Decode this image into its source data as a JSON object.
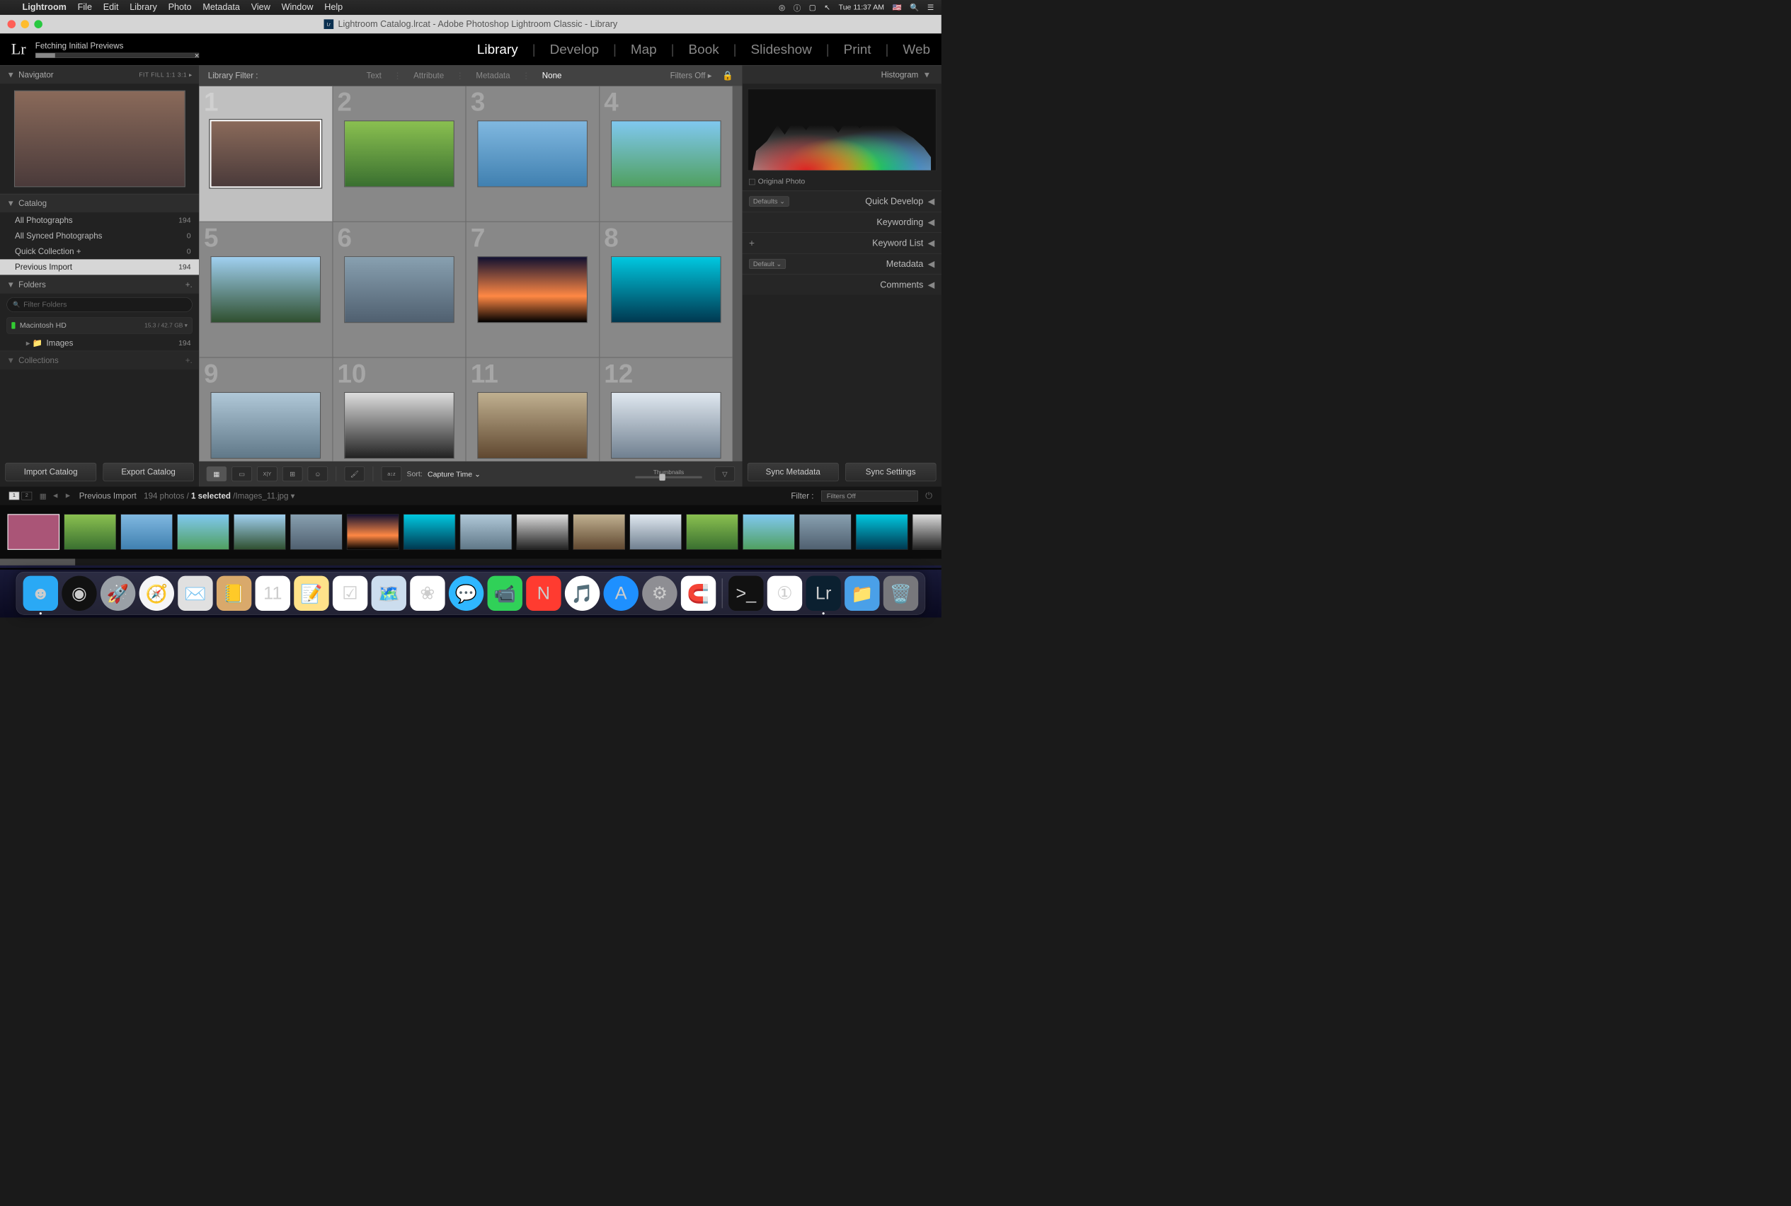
{
  "menubar": {
    "app": "Lightroom",
    "items": [
      "File",
      "Edit",
      "Library",
      "Photo",
      "Metadata",
      "View",
      "Window",
      "Help"
    ],
    "clock": "Tue 11:37 AM"
  },
  "window": {
    "title": "Lightroom Catalog.lrcat - Adobe Photoshop Lightroom Classic - Library"
  },
  "header": {
    "logo": "Lr",
    "status": "Fetching Initial Previews",
    "modules": [
      "Library",
      "Develop",
      "Map",
      "Book",
      "Slideshow",
      "Print",
      "Web"
    ],
    "active_module": "Library"
  },
  "left": {
    "navigator": {
      "title": "Navigator",
      "zoom_opts": "FIT   FILL   1:1   3:1  ▸"
    },
    "catalog": {
      "title": "Catalog",
      "items": [
        {
          "label": "All Photographs",
          "count": "194"
        },
        {
          "label": "All Synced Photographs",
          "count": "0"
        },
        {
          "label": "Quick Collection  +",
          "count": "0"
        },
        {
          "label": "Previous Import",
          "count": "194",
          "selected": true
        }
      ]
    },
    "folders": {
      "title": "Folders",
      "filter_placeholder": "Filter Folders",
      "volume": {
        "name": "Macintosh HD",
        "cap": "15.3 / 42.7 GB  ▾"
      },
      "items": [
        {
          "label": "Images",
          "count": "194"
        }
      ]
    },
    "collections": {
      "title": "Collections"
    },
    "footer": {
      "import": "Import Catalog",
      "export": "Export Catalog"
    }
  },
  "filterbar": {
    "label": "Library Filter :",
    "opts": [
      "Text",
      "Attribute",
      "Metadata",
      "None"
    ],
    "active": "None",
    "filters_off": "Filters Off  ▸"
  },
  "grid": {
    "cells": [
      1,
      2,
      3,
      4,
      5,
      6,
      7,
      8,
      9,
      10,
      11,
      12
    ],
    "selected": 1
  },
  "toolbar": {
    "sort_label": "Sort:",
    "sort_value": "Capture Time",
    "thumbnails_label": "Thumbnails"
  },
  "right": {
    "histogram_title": "Histogram",
    "original_photo": "Original Photo",
    "rows": [
      {
        "label": "Quick Develop",
        "dropdown": "Defaults"
      },
      {
        "label": "Keywording"
      },
      {
        "label": "Keyword List",
        "plus": true
      },
      {
        "label": "Metadata",
        "dropdown": "Default"
      },
      {
        "label": "Comments"
      }
    ],
    "footer": {
      "sync_meta": "Sync Metadata",
      "sync_settings": "Sync Settings"
    }
  },
  "filmstrip_meta": {
    "source": "Previous Import",
    "count": "194 photos",
    "selected": "1 selected",
    "file": "Images_11.jpg",
    "filter_label": "Filter :",
    "filter_value": "Filters Off"
  },
  "dock": {
    "icons": [
      {
        "name": "finder",
        "color": "#2aa9f5",
        "glyph": "☻",
        "round": false,
        "running": true
      },
      {
        "name": "siri",
        "color": "#111",
        "glyph": "◉",
        "round": true
      },
      {
        "name": "launchpad",
        "color": "#9aa0a6",
        "glyph": "🚀",
        "round": true
      },
      {
        "name": "safari",
        "color": "#f5f5f7",
        "glyph": "🧭",
        "round": true
      },
      {
        "name": "mail",
        "color": "#e0e0e0",
        "glyph": "✉️",
        "round": false
      },
      {
        "name": "contacts",
        "color": "#d9a96b",
        "glyph": "📒",
        "round": false
      },
      {
        "name": "calendar",
        "color": "#fff",
        "glyph": "11",
        "round": false
      },
      {
        "name": "notes",
        "color": "#ffe28a",
        "glyph": "📝",
        "round": false
      },
      {
        "name": "reminders",
        "color": "#fff",
        "glyph": "☑︎",
        "round": false
      },
      {
        "name": "maps",
        "color": "#cde",
        "glyph": "🗺️",
        "round": false
      },
      {
        "name": "photos",
        "color": "#fff",
        "glyph": "❀",
        "round": false
      },
      {
        "name": "messages",
        "color": "#2fb7ff",
        "glyph": "💬",
        "round": true
      },
      {
        "name": "facetime",
        "color": "#30d158",
        "glyph": "📹",
        "round": false
      },
      {
        "name": "news",
        "color": "#ff3b30",
        "glyph": "N",
        "round": false
      },
      {
        "name": "music",
        "color": "#fff",
        "glyph": "🎵",
        "round": true
      },
      {
        "name": "appstore",
        "color": "#1e90ff",
        "glyph": "A",
        "round": true
      },
      {
        "name": "preferences",
        "color": "#8e8e93",
        "glyph": "⚙︎",
        "round": true
      },
      {
        "name": "magnet",
        "color": "#fff",
        "glyph": "🧲",
        "round": false
      }
    ],
    "right_icons": [
      {
        "name": "terminal",
        "color": "#111",
        "glyph": ">_",
        "round": false
      },
      {
        "name": "1password",
        "color": "#fff",
        "glyph": "①",
        "round": false
      },
      {
        "name": "lightroom",
        "color": "#0b2030",
        "glyph": "Lr",
        "round": false,
        "running": true
      },
      {
        "name": "downloads",
        "color": "#4aa0e8",
        "glyph": "📁",
        "round": false
      },
      {
        "name": "trash",
        "color": "#78787c",
        "glyph": "🗑️",
        "round": false
      }
    ]
  }
}
